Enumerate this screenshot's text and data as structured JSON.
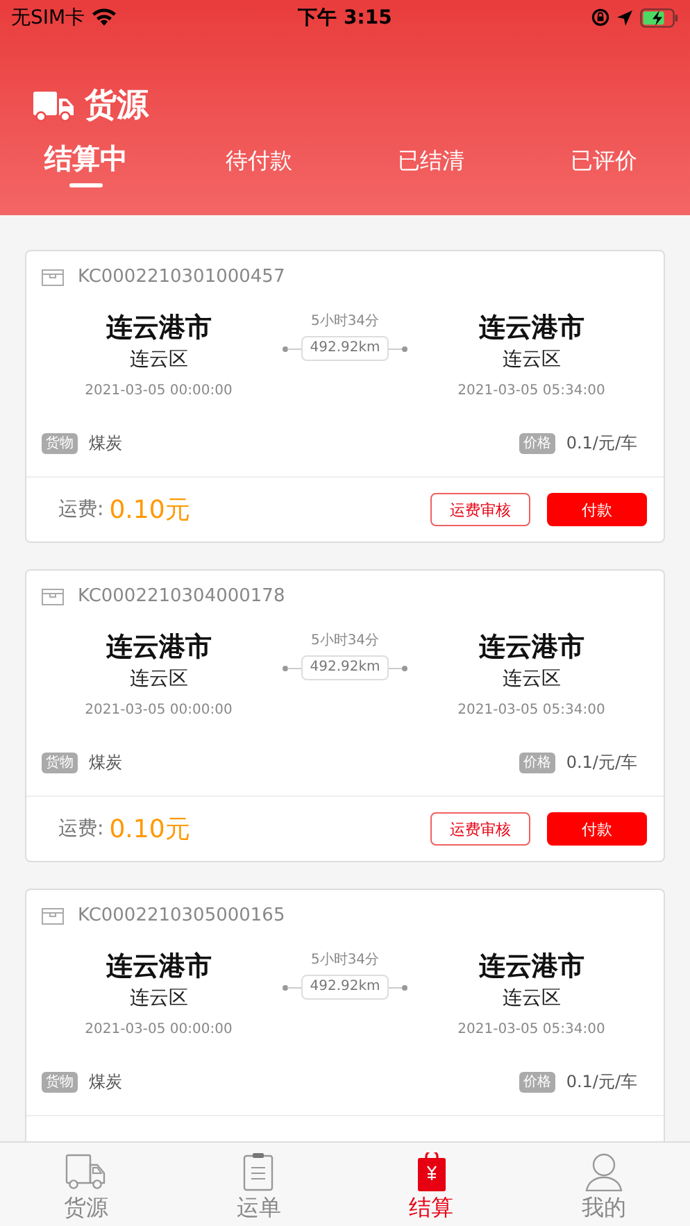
{
  "status_bar": {
    "carrier": "无SIM卡",
    "time": "下午 3:15"
  },
  "header": {
    "title": "货源"
  },
  "tabs": [
    {
      "label": "结算中",
      "selected": true
    },
    {
      "label": "待付款",
      "selected": false
    },
    {
      "label": "已结清",
      "selected": false
    },
    {
      "label": "已评价",
      "selected": false
    }
  ],
  "orders": [
    {
      "id": "KC0002210301000457",
      "origin": {
        "city": "连云港市",
        "district": "连云区",
        "time": "2021-03-05 00:00:00"
      },
      "destination": {
        "city": "连云港市",
        "district": "连云区",
        "time": "2021-03-05 05:34:00"
      },
      "duration": "5小时34分",
      "distance": "492.92km",
      "cargo_label": "货物",
      "cargo": "煤炭",
      "price_label": "价格",
      "price": "0.1/元/车",
      "fee_label": "运费:",
      "fee": "0.10元",
      "buttons": [
        {
          "label": "运费审核",
          "kind": "outline"
        },
        {
          "label": "付款",
          "kind": "primary"
        }
      ]
    },
    {
      "id": "KC0002210304000178",
      "origin": {
        "city": "连云港市",
        "district": "连云区",
        "time": "2021-03-05 00:00:00"
      },
      "destination": {
        "city": "连云港市",
        "district": "连云区",
        "time": "2021-03-05 05:34:00"
      },
      "duration": "5小时34分",
      "distance": "492.92km",
      "cargo_label": "货物",
      "cargo": "煤炭",
      "price_label": "价格",
      "price": "0.1/元/车",
      "fee_label": "运费:",
      "fee": "0.10元",
      "buttons": [
        {
          "label": "运费审核",
          "kind": "outline"
        },
        {
          "label": "付款",
          "kind": "primary"
        }
      ]
    },
    {
      "id": "KC0002210305000165",
      "origin": {
        "city": "连云港市",
        "district": "连云区",
        "time": "2021-03-05 00:00:00"
      },
      "destination": {
        "city": "连云港市",
        "district": "连云区",
        "time": "2021-03-05 05:34:00"
      },
      "duration": "5小时34分",
      "distance": "492.92km",
      "cargo_label": "货物",
      "cargo": "煤炭",
      "price_label": "价格",
      "price": "0.1/元/车"
    }
  ],
  "tab_bar": [
    {
      "label": "货源",
      "selected": false
    },
    {
      "label": "运单",
      "selected": false
    },
    {
      "label": "结算",
      "selected": true
    },
    {
      "label": "我的",
      "selected": false
    }
  ]
}
